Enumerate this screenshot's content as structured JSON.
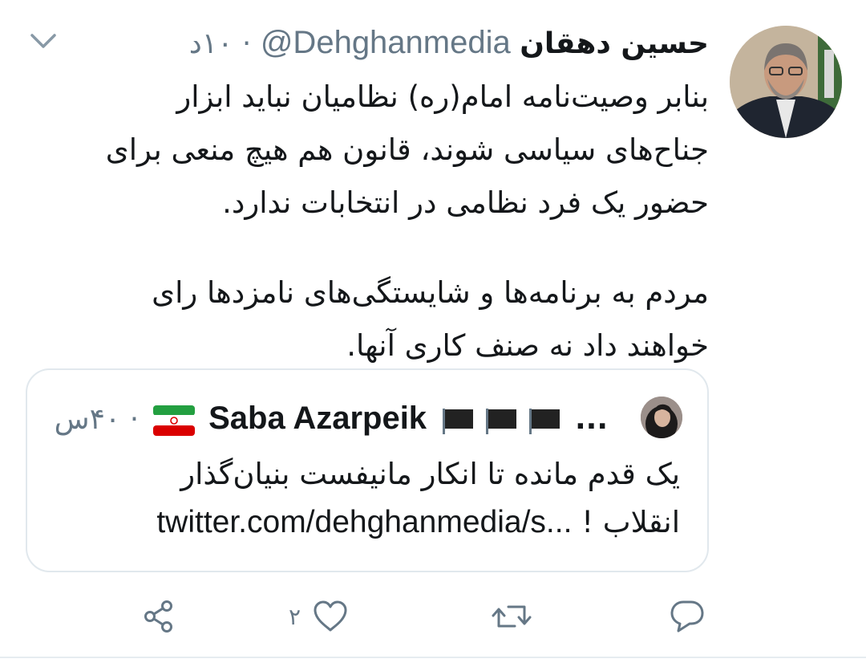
{
  "tweet": {
    "author_name": "حسین دهقان",
    "handle": "@Dehghanmedia",
    "time": "۱۰د",
    "separator": "·",
    "body_lines": [
      "بنابر وصیت‌نامه امام(ره) نظامیان نباید ابزار",
      "جناح‌های سیاسی شوند، قانون هم هیچ منعی برای",
      "حضور یک فرد نظامی در انتخابات ندارد."
    ],
    "body_lines_2": [
      "مردم به برنامه‌ها و شایستگی‌های نامزدها رای",
      "خواهند داد نه صنف کاری آنها."
    ]
  },
  "quoted": {
    "author_name": "Saba Azarpeik",
    "ellipsis": "...",
    "time": "۴۰س",
    "separator": "·",
    "text_line_1": "یک قدم مانده تا انکار مانیفست بنیان‌گذار",
    "text_line_2_word": "انقلاب !",
    "text_line_2_url": "twitter.com/dehghanmedia/s..."
  },
  "actions": {
    "reply_count": "",
    "retweet_count": "",
    "like_count": "۲",
    "share_count": ""
  },
  "colors": {
    "text": "#14171a",
    "muted": "#657786",
    "border": "#e1e8ed",
    "flag_green": "#239f40",
    "flag_red": "#da0000"
  },
  "icons": [
    "chevron-down-icon",
    "black-flag-icon",
    "iran-flag-icon",
    "reply-icon",
    "retweet-icon",
    "like-icon",
    "share-icon"
  ]
}
